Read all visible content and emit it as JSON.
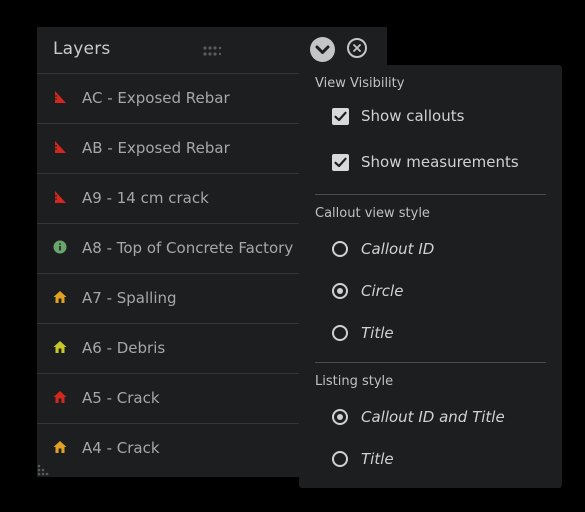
{
  "layers_panel": {
    "title": "Layers",
    "items": [
      {
        "label": "AC - Exposed Rebar",
        "icon": "measurement-triangle-icon",
        "color": "#d0281f"
      },
      {
        "label": "AB - Exposed Rebar",
        "icon": "measurement-triangle-icon",
        "color": "#d0281f"
      },
      {
        "label": "A9 - 14 cm crack",
        "icon": "measurement-triangle-icon",
        "color": "#d0281f"
      },
      {
        "label": "A8 - Top of Concrete Factory",
        "icon": "info-circle-icon",
        "color": "#6aa56e"
      },
      {
        "label": "A7 - Spalling",
        "icon": "house-callout-icon",
        "color": "#e0a125"
      },
      {
        "label": "A6 - Debris",
        "icon": "house-callout-icon",
        "color": "#c7c72a"
      },
      {
        "label": "A5 - Crack",
        "icon": "house-callout-icon",
        "color": "#d0281f"
      },
      {
        "label": "A4 - Crack",
        "icon": "house-callout-icon",
        "color": "#e0a125"
      }
    ]
  },
  "options_menu": {
    "view_visibility": {
      "title": "View Visibility",
      "options": [
        {
          "label": "Show callouts",
          "checked": true
        },
        {
          "label": "Show measurements",
          "checked": true
        }
      ]
    },
    "callout_view_style": {
      "title": "Callout view style",
      "options": [
        {
          "label": "Callout ID",
          "selected": false
        },
        {
          "label": "Circle",
          "selected": true
        },
        {
          "label": "Title",
          "selected": false
        }
      ]
    },
    "listing_style": {
      "title": "Listing style",
      "options": [
        {
          "label": "Callout ID and Title",
          "selected": true
        },
        {
          "label": "Title",
          "selected": false
        }
      ]
    }
  },
  "colors": {
    "panel_bg": "#1d1e20",
    "control_light": "#d0d1d3",
    "alert_red": "#d0281f",
    "warning_orange": "#e0a125",
    "caution_yellow": "#c7c72a",
    "info_green": "#6aa56e"
  }
}
